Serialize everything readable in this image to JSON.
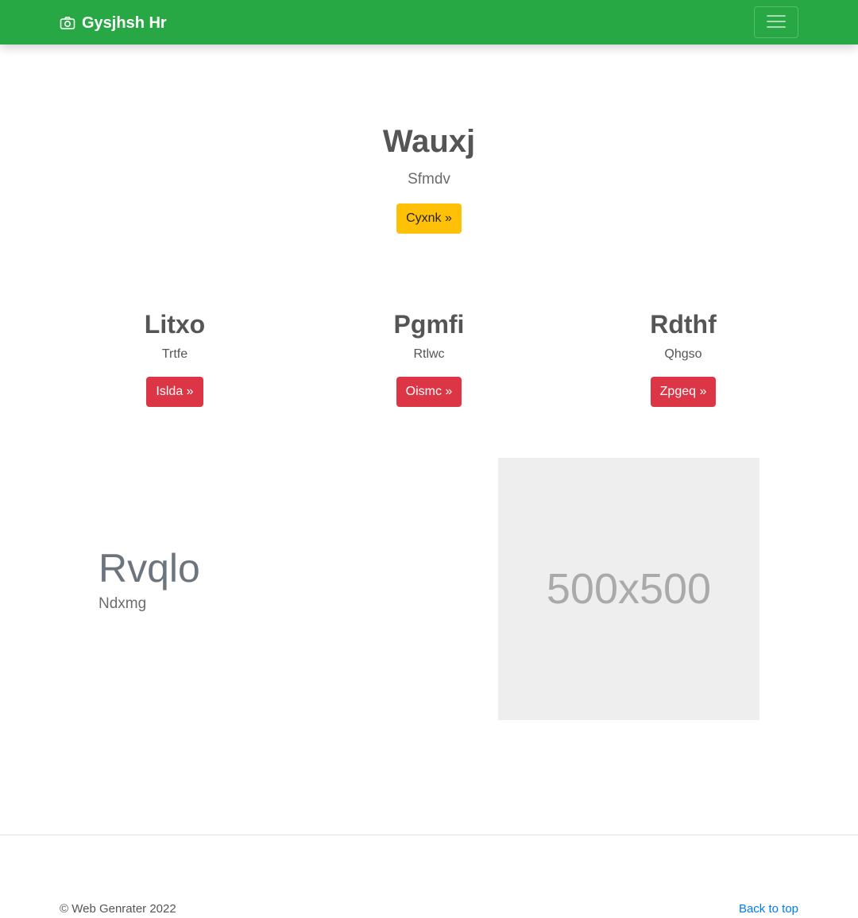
{
  "navbar": {
    "brand": "Gysjhsh Hr",
    "brand_icon": "camera-icon",
    "toggler_icon": "hamburger-icon",
    "color": "#28a745"
  },
  "hero": {
    "title": "Wauxj",
    "lead": "Sfmdv",
    "button_label": "Cyxnk »",
    "button_color": "#ffc107"
  },
  "features": [
    {
      "title": "Litxo",
      "text": "Trtfe",
      "button_label": "Islda »"
    },
    {
      "title": "Pgmfi",
      "text": "Rtlwc",
      "button_label": "Oismc »"
    },
    {
      "title": "Rdthf",
      "text": "Qhgso",
      "button_label": "Zpgeq »"
    }
  ],
  "feature_button_color": "#dc3545",
  "split": {
    "title": "Rvqlo",
    "text": "Ndxmg",
    "image_label": "500x500"
  },
  "footer": {
    "copyright": "© Web Genrater 2022",
    "back_to_top": "Back to top",
    "link_color": "#007bff"
  }
}
